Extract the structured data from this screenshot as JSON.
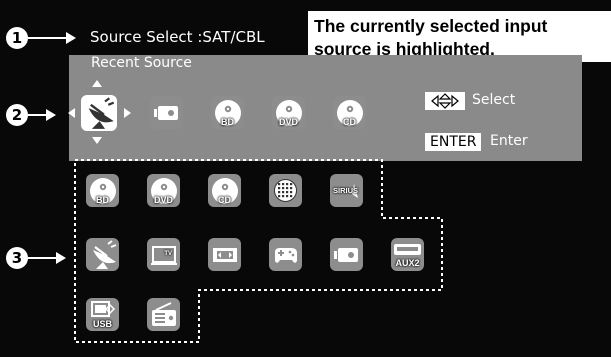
{
  "header": {
    "source_select": "Source Select  :SAT/CBL",
    "recent_source": "Recent Source"
  },
  "callout": {
    "line1": "The currently selected input",
    "line2": "source is highlighted."
  },
  "markers": [
    "1",
    "2",
    "3"
  ],
  "hints": {
    "select_label": "Select",
    "enter_key": "ENTER",
    "enter_label": "Enter"
  },
  "recent_sources": [
    {
      "icon": "satellite-dish-icon",
      "selected": true
    },
    {
      "icon": "media-player-icon"
    },
    {
      "icon": "bd-disc-icon",
      "label": "BD"
    },
    {
      "icon": "dvd-disc-icon",
      "label": "DVD"
    },
    {
      "icon": "cd-disc-icon",
      "label": "CD"
    }
  ],
  "sources": [
    {
      "icon": "bd-disc-icon",
      "label": "BD"
    },
    {
      "icon": "dvd-disc-icon",
      "label": "DVD"
    },
    {
      "icon": "cd-disc-icon",
      "label": "CD"
    },
    {
      "icon": "network-icon"
    },
    {
      "icon": "sirius-icon",
      "label": "SIRIUS"
    },
    {
      "icon": "satellite-dish-icon"
    },
    {
      "icon": "tv-icon",
      "label": "TV"
    },
    {
      "icon": "vcr-icon"
    },
    {
      "icon": "game-controller-icon"
    },
    {
      "icon": "media-player-icon"
    },
    {
      "icon": "aux2-icon",
      "label": "AUX2"
    },
    {
      "icon": "usb-icon",
      "label": "USB"
    },
    {
      "icon": "radio-icon"
    }
  ],
  "colors": {
    "screen_bg": "#080808",
    "panel_bg": "#8a8a8a",
    "icon_bg": "#8d8d8d",
    "highlight": "#ffffff"
  }
}
